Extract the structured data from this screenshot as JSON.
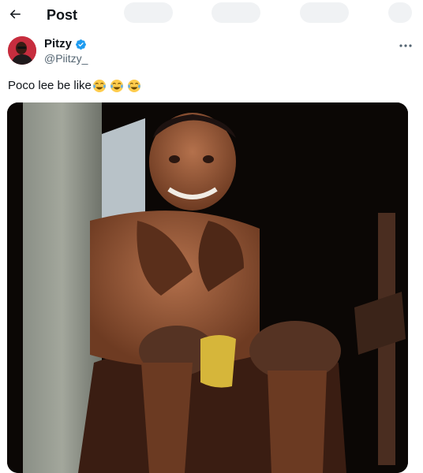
{
  "header": {
    "title": "Post"
  },
  "author": {
    "display_name": "Pitzy",
    "handle": "@Piitzy_"
  },
  "post": {
    "text": "Poco lee be like",
    "emojis": [
      "face-with-tears-of-joy",
      "face-with-tears-of-joy",
      "face-with-tears-of-joy"
    ]
  },
  "icons": {
    "back": "back-arrow-icon",
    "verified": "verified-badge-icon",
    "more": "more-options-icon"
  },
  "colors": {
    "verified": "#1d9bf0",
    "secondary_text": "#536471",
    "text": "#0f1419"
  }
}
